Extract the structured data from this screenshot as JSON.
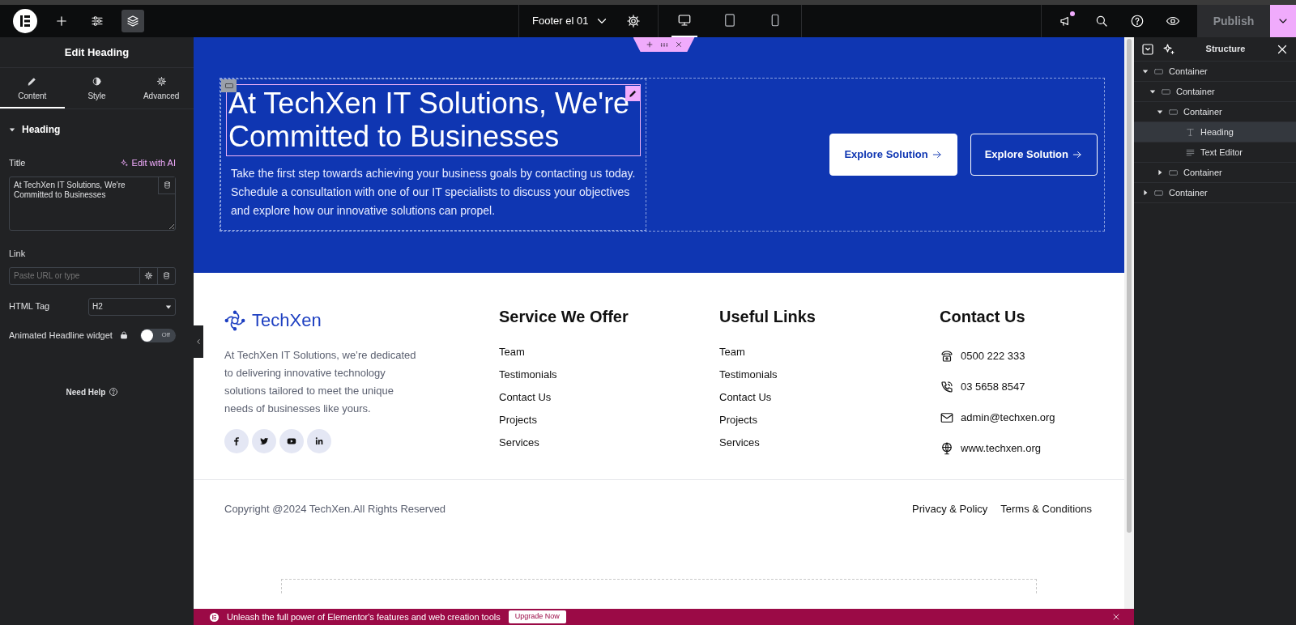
{
  "topbar": {
    "document": "Footer el 01",
    "devices": [
      {
        "kind": "desktop",
        "selected": true
      },
      {
        "kind": "tablet",
        "selected": false
      },
      {
        "kind": "mobile",
        "selected": false
      }
    ],
    "notification": true,
    "publish": "Publish"
  },
  "panel": {
    "title": "Edit Heading",
    "tabs": [
      {
        "label": "Content",
        "kind": "pencil",
        "selected": true
      },
      {
        "label": "Style",
        "kind": "contrast",
        "selected": false
      },
      {
        "label": "Advanced",
        "kind": "gear",
        "selected": false
      }
    ],
    "section": {
      "label": "Heading",
      "expanded": true
    },
    "title_label": "Title",
    "ai_link": "Edit with AI",
    "title_value": "At TechXen IT Solutions, We're Committed to Businesses",
    "link_label": "Link",
    "link": {
      "placeholder": "Paste URL or type"
    },
    "tag_label": "HTML Tag",
    "tag_value": "H2",
    "animated_label": "Animated Headline widget",
    "animated": {
      "on": false,
      "label": "Off"
    },
    "help": "Need Help"
  },
  "hero": {
    "heading": "At TechXen IT Solutions, We're Committed to Businesses",
    "text": "Take the first step towards achieving your business goals by contacting us today. Schedule a consultation with one of our IT specialists to discuss your objectives and explore how our innovative solutions can propel.",
    "buttons": [
      {
        "label": "Explore Solution",
        "kind": "solid"
      },
      {
        "label": "Explore Solution",
        "kind": "outline"
      }
    ]
  },
  "footer": {
    "brand": "TechXen",
    "about": "At TechXen IT Solutions, we’re dedicated to delivering innovative technology solutions tailored to meet the unique needs of businesses like yours.",
    "social": [
      {
        "kind": "facebook"
      },
      {
        "kind": "twitter"
      },
      {
        "kind": "youtube"
      },
      {
        "kind": "linkedin"
      }
    ],
    "columns": [
      {
        "title": "Service We Offer",
        "links": [
          "Team",
          "Testimonials",
          "Contact Us",
          "Projects",
          "Services"
        ]
      },
      {
        "title": "Useful Links",
        "links": [
          "Team",
          "Testimonials",
          "Contact Us",
          "Projects",
          "Services"
        ]
      }
    ],
    "contact": {
      "title": "Contact Us",
      "items": [
        {
          "kind": "phone",
          "text": "0500 222 333"
        },
        {
          "kind": "call",
          "text": "03 5658 8547"
        },
        {
          "kind": "mail",
          "text": "admin@techxen.org"
        },
        {
          "kind": "web",
          "text": "www.techxen.org"
        }
      ]
    },
    "copyright": "Copyright @2024 TechXen.All Rights Reserved",
    "legal": [
      "Privacy & Policy",
      "Terms & Conditions"
    ]
  },
  "banner": {
    "text": "Unleash the full power of Elementor's features and web creation tools",
    "button": "Upgrade Now"
  },
  "structure": {
    "title": "Structure",
    "items": [
      {
        "label": "Container",
        "kind": "container",
        "expanded": true,
        "selected": false,
        "children": [
          {
            "label": "Container",
            "kind": "container",
            "expanded": true,
            "selected": false,
            "children": [
              {
                "label": "Container",
                "kind": "container",
                "expanded": true,
                "selected": false,
                "children": [
                  {
                    "label": "Heading",
                    "kind": "heading",
                    "selected": true
                  },
                  {
                    "label": "Text Editor",
                    "kind": "text",
                    "selected": false
                  }
                ]
              },
              {
                "label": "Container",
                "kind": "container",
                "expanded": false,
                "selected": false
              }
            ]
          }
        ]
      },
      {
        "label": "Container",
        "kind": "container",
        "expanded": false,
        "selected": false
      }
    ]
  }
}
